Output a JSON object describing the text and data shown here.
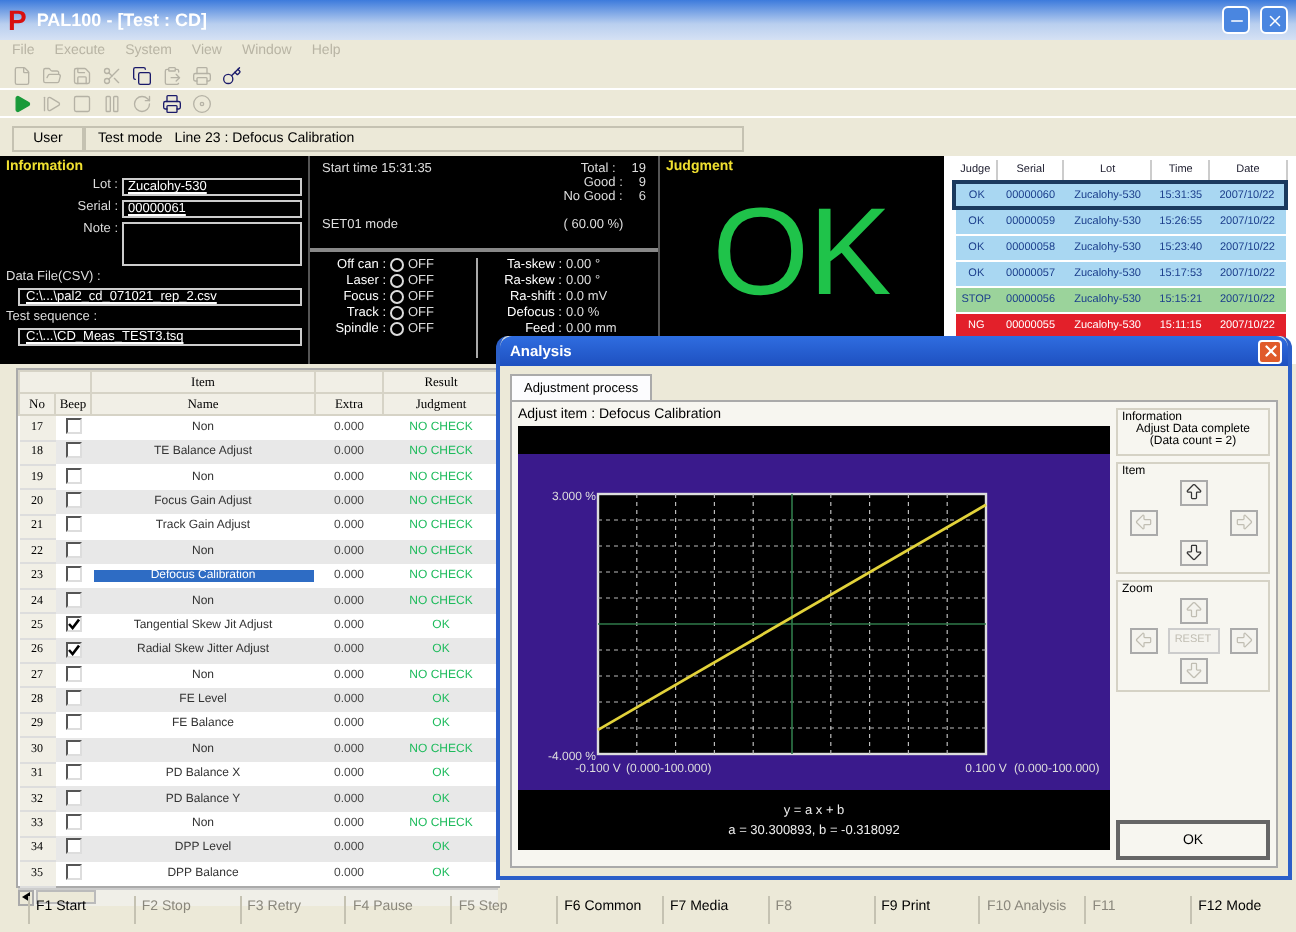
{
  "window": {
    "logo": "P",
    "title": "PAL100 - [Test : CD]"
  },
  "menu": [
    {
      "label": "File",
      "disabled": true
    },
    {
      "label": "Execute",
      "disabled": true
    },
    {
      "label": "System",
      "disabled": true
    },
    {
      "label": "View",
      "disabled": true
    },
    {
      "label": "Window",
      "disabled": true
    },
    {
      "label": "Help",
      "disabled": true
    }
  ],
  "toolbars": [
    [
      {
        "kind": "new",
        "disabled": true
      },
      {
        "kind": "open",
        "disabled": true
      },
      {
        "kind": "save",
        "disabled": true
      },
      {
        "kind": "cut",
        "disabled": true
      },
      {
        "kind": "copy",
        "disabled": false
      },
      {
        "kind": "paste",
        "disabled": true
      },
      {
        "kind": "print",
        "disabled": true
      },
      {
        "kind": "key",
        "disabled": false
      }
    ],
    [
      {
        "kind": "play",
        "disabled": false
      },
      {
        "kind": "step",
        "disabled": true
      },
      {
        "kind": "stop",
        "disabled": true
      },
      {
        "kind": "pause",
        "disabled": true
      },
      {
        "kind": "retry",
        "disabled": true
      },
      {
        "kind": "print",
        "disabled": false
      },
      {
        "kind": "media",
        "disabled": true
      }
    ]
  ],
  "status": {
    "user": "User",
    "mode": "Test mode",
    "line": "Line 23 : Defocus Calibration"
  },
  "information": {
    "title": "Information",
    "lot_label": "Lot :",
    "lot": "Zucalohy-530",
    "serial_label": "Serial :",
    "serial": "00000061",
    "note_label": "Note :",
    "data_file_label": "Data File(CSV) :",
    "data_file": "C:\\...\\pal2_cd_071021_rep_2.csv",
    "sequence_label": "Test sequence :",
    "sequence": "C:\\...\\CD_Meas_TEST3.tsq"
  },
  "summary": {
    "start_time": "Start time 15:31:35",
    "mode": "SET01 mode",
    "counts": [
      {
        "label": "Total :",
        "value": "19"
      },
      {
        "label": "Good :",
        "value": "9"
      },
      {
        "label": "No Good :",
        "value": "6"
      }
    ],
    "ratio": "( 60.00 %)"
  },
  "switches": [
    {
      "label": "Off can :",
      "state": "OFF",
      "on": false
    },
    {
      "label": "Laser :",
      "state": "OFF",
      "on": false
    },
    {
      "label": "Focus :",
      "state": "OFF",
      "on": false
    },
    {
      "label": "Track :",
      "state": "OFF",
      "on": false
    },
    {
      "label": "Spindle :",
      "state": "OFF",
      "on": false
    }
  ],
  "readings": [
    {
      "label": "Ta-skew :",
      "value": "0.00 °"
    },
    {
      "label": "Ra-skew :",
      "value": "0.00 °"
    },
    {
      "label": "Ra-shift :",
      "value": "0.0 mV"
    },
    {
      "label": "Defocus :",
      "value": "0.0 %"
    },
    {
      "label": "Feed :",
      "value": "0.00 mm"
    }
  ],
  "judgment": {
    "title": "Judgment",
    "result": "OK"
  },
  "history": {
    "columns": [
      "Judge",
      "Serial",
      "Lot",
      "Time",
      "Date"
    ],
    "rows": [
      {
        "cells": [
          "OK",
          "00000060",
          "Zucalohy-530",
          "15:31:35",
          "2007/10/22"
        ],
        "color": "#a9d7f2",
        "selected": true
      },
      {
        "cells": [
          "OK",
          "00000059",
          "Zucalohy-530",
          "15:26:55",
          "2007/10/22"
        ],
        "color": "#a9d7f2",
        "selected": false
      },
      {
        "cells": [
          "OK",
          "00000058",
          "Zucalohy-530",
          "15:23:40",
          "2007/10/22"
        ],
        "color": "#a9d7f2",
        "selected": false
      },
      {
        "cells": [
          "OK",
          "00000057",
          "Zucalohy-530",
          "15:17:53",
          "2007/10/22"
        ],
        "color": "#a9d7f2",
        "selected": false
      },
      {
        "cells": [
          "STOP",
          "00000056",
          "Zucalohy-530",
          "15:15:21",
          "2007/10/22"
        ],
        "color": "#9bd39b",
        "selected": false
      },
      {
        "cells": [
          "NG",
          "00000055",
          "Zucalohy-530",
          "15:11:15",
          "2007/10/22"
        ],
        "color": "#e3202a",
        "selected": false
      }
    ]
  },
  "items": {
    "groups": [
      {
        "label": "Item"
      },
      {
        "label": "Result"
      }
    ],
    "columns": [
      "No",
      "Beep",
      "Name",
      "Extra",
      "Judgment"
    ],
    "rows": [
      {
        "no": "17",
        "beep": false,
        "name": "Non",
        "extra": "0.000",
        "judgment": "NO CHECK",
        "selected": false
      },
      {
        "no": "18",
        "beep": false,
        "name": "TE Balance Adjust",
        "extra": "0.000",
        "judgment": "NO CHECK",
        "selected": false
      },
      {
        "no": "19",
        "beep": false,
        "name": "Non",
        "extra": "0.000",
        "judgment": "NO CHECK",
        "selected": false
      },
      {
        "no": "20",
        "beep": false,
        "name": "Focus Gain Adjust",
        "extra": "0.000",
        "judgment": "NO CHECK",
        "selected": false
      },
      {
        "no": "21",
        "beep": false,
        "name": "Track Gain Adjust",
        "extra": "0.000",
        "judgment": "NO CHECK",
        "selected": false
      },
      {
        "no": "22",
        "beep": false,
        "name": "Non",
        "extra": "0.000",
        "judgment": "NO CHECK",
        "selected": false
      },
      {
        "no": "23",
        "beep": false,
        "name": "Defocus Calibration",
        "extra": "0.000",
        "judgment": "NO CHECK",
        "selected": true
      },
      {
        "no": "24",
        "beep": false,
        "name": "Non",
        "extra": "0.000",
        "judgment": "NO CHECK",
        "selected": false
      },
      {
        "no": "25",
        "beep": true,
        "name": "Tangential Skew Jit Adjust",
        "extra": "0.000",
        "judgment": "OK",
        "selected": false
      },
      {
        "no": "26",
        "beep": true,
        "name": "Radial Skew Jitter Adjust",
        "extra": "0.000",
        "judgment": "OK",
        "selected": false
      },
      {
        "no": "27",
        "beep": false,
        "name": "Non",
        "extra": "0.000",
        "judgment": "NO CHECK",
        "selected": false
      },
      {
        "no": "28",
        "beep": false,
        "name": "FE Level",
        "extra": "0.000",
        "judgment": "OK",
        "selected": false
      },
      {
        "no": "29",
        "beep": false,
        "name": "FE Balance",
        "extra": "0.000",
        "judgment": "OK",
        "selected": false
      },
      {
        "no": "30",
        "beep": false,
        "name": "Non",
        "extra": "0.000",
        "judgment": "NO CHECK",
        "selected": false
      },
      {
        "no": "31",
        "beep": false,
        "name": "PD Balance X",
        "extra": "0.000",
        "judgment": "OK",
        "selected": false
      },
      {
        "no": "32",
        "beep": false,
        "name": "PD Balance Y",
        "extra": "0.000",
        "judgment": "OK",
        "selected": false
      },
      {
        "no": "33",
        "beep": false,
        "name": "Non",
        "extra": "0.000",
        "judgment": "NO CHECK",
        "selected": false
      },
      {
        "no": "34",
        "beep": false,
        "name": "DPP Level",
        "extra": "0.000",
        "judgment": "OK",
        "selected": false
      },
      {
        "no": "35",
        "beep": false,
        "name": "DPP Balance",
        "extra": "0.000",
        "judgment": "OK",
        "selected": false
      }
    ]
  },
  "analysis": {
    "title": "Analysis",
    "tabs": [
      {
        "label": "Adjustment process",
        "selected": true
      }
    ],
    "adjust_item": "Adjust item : Defocus Calibration",
    "chart_data": {
      "type": "line",
      "x": [
        -0.1,
        0.1
      ],
      "series": [
        {
          "color": "#e2d23a",
          "values": [
            -3.35,
            2.71
          ]
        }
      ],
      "ref_lines": [
        {
          "axis": "x",
          "value": 0,
          "color": "#2f7a4a"
        },
        {
          "axis": "y",
          "value": -0.5,
          "color": "#2f7a4a"
        }
      ],
      "xlim": [
        -0.1,
        0.1
      ],
      "ylim": [
        -4,
        3
      ],
      "xticks": [
        {
          "value": -0.1,
          "label": "-0.100 V"
        },
        {
          "value": 0.1,
          "label": "0.100 V"
        }
      ],
      "yticks": [
        {
          "value": -4,
          "label": "-4.000 %"
        },
        {
          "value": 3,
          "label": "3.000 %"
        }
      ]
    },
    "x_ranges": [
      "(0.000-100.000)",
      "(0.000-100.000)"
    ],
    "formula": "y = a x + b",
    "coefficients": "a = 30.300893, b = -0.318092",
    "info_title": "Information",
    "info_lines": [
      "Adjust Data complete",
      "(Data count = 2)"
    ],
    "item_title": "Item",
    "item_buttons": [
      {
        "kind": "up",
        "disabled": false
      },
      {
        "kind": "left",
        "disabled": true
      },
      {
        "kind": "right",
        "disabled": true
      },
      {
        "kind": "down",
        "disabled": false
      }
    ],
    "zoom_title": "Zoom",
    "zoom_buttons": [
      {
        "kind": "up",
        "disabled": true
      },
      {
        "kind": "left",
        "disabled": true
      },
      {
        "kind": "reset",
        "label": "RESET",
        "disabled": true
      },
      {
        "kind": "right",
        "disabled": true
      },
      {
        "kind": "down",
        "disabled": true
      }
    ],
    "ok": "OK"
  },
  "function_keys": [
    {
      "label": "F1 Start",
      "disabled": false
    },
    {
      "label": "F2 Stop",
      "disabled": true
    },
    {
      "label": "F3 Retry",
      "disabled": true
    },
    {
      "label": "F4 Pause",
      "disabled": true
    },
    {
      "label": "F5 Step",
      "disabled": true
    },
    {
      "label": "F6 Common",
      "disabled": false
    },
    {
      "label": "F7 Media",
      "disabled": false
    },
    {
      "label": "F8",
      "disabled": true
    },
    {
      "label": "F9 Print",
      "disabled": false
    },
    {
      "label": "F10 Analysis",
      "disabled": true
    },
    {
      "label": "F11",
      "disabled": true
    },
    {
      "label": "F12 Mode",
      "disabled": false
    }
  ]
}
